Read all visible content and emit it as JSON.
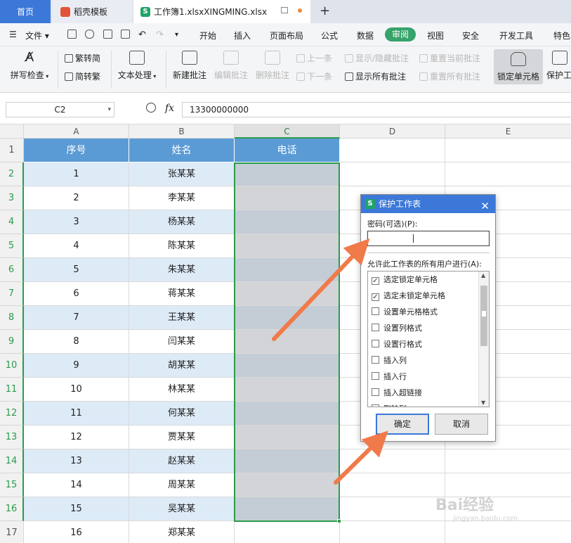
{
  "tabs": {
    "home": "首页",
    "template": "稻壳模板",
    "doc": "工作簿1.xlsxXINGMING.xlsx"
  },
  "menu": {
    "file": "文件",
    "items": [
      "开始",
      "插入",
      "页面布局",
      "公式",
      "数据",
      "审阅",
      "视图",
      "安全",
      "开发工具",
      "特色"
    ],
    "active": "审阅"
  },
  "ribbon": {
    "spell_check": "拼写检查",
    "trad_to_simp": "繁转简",
    "simp_to_trad": "简转繁",
    "text_processing": "文本处理",
    "new_comment": "新建批注",
    "edit_comment": "编辑批注",
    "delete_comment": "删除批注",
    "prev": "上一条",
    "next": "下一条",
    "show_hide_comment": "显示/隐藏批注",
    "show_all_comments": "显示所有批注",
    "reset_current_comment": "重置当前批注",
    "reset_all_comments": "重置所有批注",
    "lock_cell": "锁定单元格",
    "protect": "保护工"
  },
  "formula_bar": {
    "name_box": "C2",
    "fx": "fx",
    "value": "13300000000"
  },
  "grid": {
    "columns": [
      "A",
      "B",
      "C",
      "D",
      "E"
    ],
    "selected_column": "C",
    "headers": [
      "序号",
      "姓名",
      "电话"
    ],
    "rows": [
      {
        "num": "2",
        "a": "1",
        "b": "张某某"
      },
      {
        "num": "3",
        "a": "2",
        "b": "李某某"
      },
      {
        "num": "4",
        "a": "3",
        "b": "杨某某"
      },
      {
        "num": "5",
        "a": "4",
        "b": "陈某某"
      },
      {
        "num": "6",
        "a": "5",
        "b": "朱某某"
      },
      {
        "num": "7",
        "a": "6",
        "b": "蒋某某"
      },
      {
        "num": "8",
        "a": "7",
        "b": "王某某"
      },
      {
        "num": "9",
        "a": "8",
        "b": "闫某某"
      },
      {
        "num": "10",
        "a": "9",
        "b": "胡某某"
      },
      {
        "num": "11",
        "a": "10",
        "b": "林某某"
      },
      {
        "num": "12",
        "a": "11",
        "b": "何某某"
      },
      {
        "num": "13",
        "a": "12",
        "b": "贾某某"
      },
      {
        "num": "14",
        "a": "13",
        "b": "赵某某"
      },
      {
        "num": "15",
        "a": "14",
        "b": "周某某"
      },
      {
        "num": "16",
        "a": "15",
        "b": "吴某某"
      },
      {
        "num": "17",
        "a": "16",
        "b": "郑某某"
      }
    ],
    "header_row_num": "1"
  },
  "dialog": {
    "title": "保护工作表",
    "password_label": "密码(可选)(P):",
    "allow_label": "允许此工作表的所有用户进行(A):",
    "options": [
      {
        "label": "选定锁定单元格",
        "checked": true
      },
      {
        "label": "选定未锁定单元格",
        "checked": true
      },
      {
        "label": "设置单元格格式",
        "checked": false
      },
      {
        "label": "设置列格式",
        "checked": false
      },
      {
        "label": "设置行格式",
        "checked": false
      },
      {
        "label": "插入列",
        "checked": false
      },
      {
        "label": "插入行",
        "checked": false
      },
      {
        "label": "插入超链接",
        "checked": false
      },
      {
        "label": "删除列",
        "checked": false
      }
    ],
    "ok": "确定",
    "cancel": "取消"
  },
  "watermark": {
    "brand": "Bai经验",
    "url": "jingyan.baidu.com"
  },
  "colors": {
    "accent_green": "#2b9b4a",
    "header_blue": "#5b9bd5",
    "band_blue": "#ddebf7",
    "arrow_orange": "#f07a4a",
    "title_blue": "#3c78d8"
  }
}
